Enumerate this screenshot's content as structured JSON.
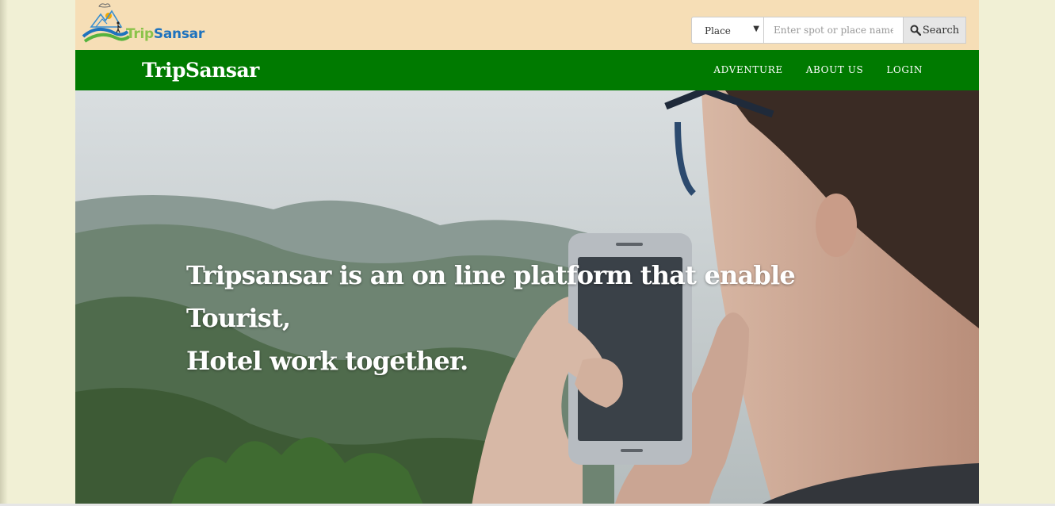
{
  "header": {
    "logo": {
      "part1": "Trip",
      "part2": "Sansar"
    },
    "search": {
      "category_selected": "Place",
      "placeholder": "Enter spot or place name .",
      "button_label": "Search"
    }
  },
  "navbar": {
    "brand": "TripSansar",
    "links": [
      "ADVENTURE",
      "ABOUT US",
      "LOGIN"
    ]
  },
  "hero": {
    "tagline_line1": "Tripsansar is an on line platform that enable Tourist,",
    "tagline_line2": "Hotel work together."
  },
  "colors": {
    "topbar_bg": "#f6deb6",
    "navbar_bg": "#007a00",
    "page_bg": "#f1f0d5"
  }
}
